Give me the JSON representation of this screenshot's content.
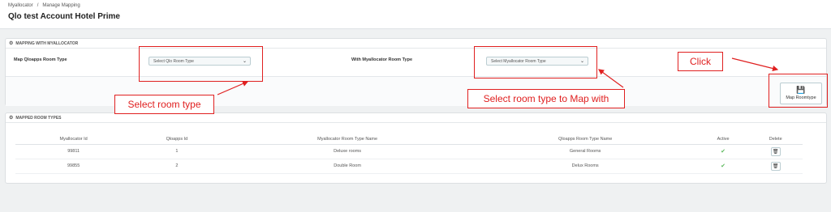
{
  "breadcrumb": [
    "Myallocator",
    "/",
    "Manage Mapping"
  ],
  "page_title": "Qlo test Account Hotel Prime",
  "mapping_panel": {
    "heading": "MAPPING WITH MYALLOCATOR",
    "qlo_label": "Map Qloapps Room Type",
    "qlo_select_value": "Select Qlo Room Type",
    "myallocator_label": "With Myallocator Room Type",
    "myallocator_select_value": "Select Myallocator Room Type",
    "map_button_label": "Map Roomtype"
  },
  "annotations": {
    "select_room_type": "Select room type",
    "select_map_with": "Select room type to Map with",
    "click": "Click",
    "color": "#e02020"
  },
  "mapped_panel": {
    "heading": "MAPPED ROOM TYPES",
    "columns": [
      "Myallocator Id",
      "Qloapps Id",
      "Myallocator Room Type Name",
      "Qloapps Room Type Name",
      "Active",
      "Delete"
    ],
    "rows": [
      {
        "myallocator_id": "99811",
        "qloapps_id": "1",
        "myallocator_name": "Deluxe rooms",
        "qloapps_name": "General Rooms",
        "active": "✔"
      },
      {
        "myallocator_id": "99855",
        "qloapps_id": "2",
        "myallocator_name": "Double Room",
        "qloapps_name": "Delux Rooms",
        "active": "✔"
      }
    ]
  },
  "icons": {
    "cog": "cog-icon",
    "chevron": "chevron-down-icon",
    "save": "floppy-disk-icon",
    "trash": "trash-icon",
    "check": "check-icon"
  }
}
